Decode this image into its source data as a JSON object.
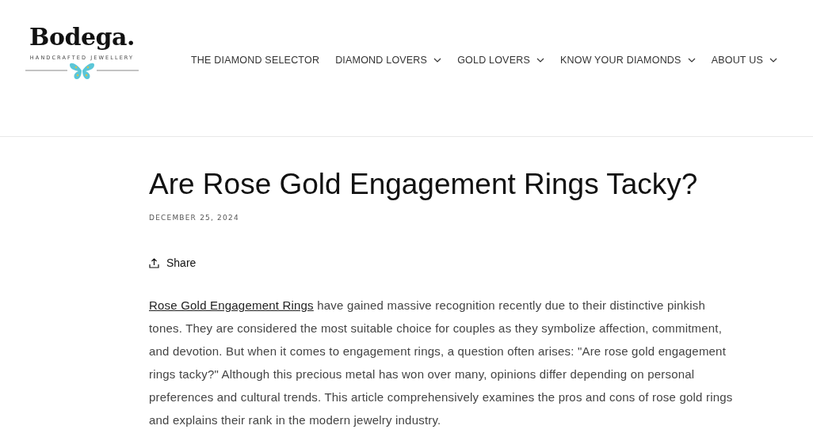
{
  "logo": {
    "name": "Bodega.",
    "tagline": "HANDCRAFTED JEWELLERY"
  },
  "nav": [
    {
      "label": "THE DIAMOND SELECTOR",
      "has_menu": false
    },
    {
      "label": "DIAMOND LOVERS",
      "has_menu": true
    },
    {
      "label": "GOLD LOVERS",
      "has_menu": true
    },
    {
      "label": "KNOW YOUR DIAMONDS",
      "has_menu": true
    },
    {
      "label": "ABOUT US",
      "has_menu": true
    }
  ],
  "article": {
    "title": "Are Rose Gold Engagement Rings Tacky?",
    "date": "DECEMBER 25, 2024",
    "share": "Share",
    "paragraph": {
      "link": "Rose Gold Engagement Rings",
      "text": " have gained massive recognition recently due to their distinctive pinkish tones. They are considered the most suitable choice for couples as they symbolize affection, commitment, and devotion. But when it comes to engagement rings, a question often arises: \"Are rose gold engagement rings tacky?\" Although this precious metal has won over many, opinions differ depending on personal preferences and cultural trends. This article comprehensively examines the pros and cons of rose gold rings and explains their rank in the modern jewelry industry."
    }
  }
}
